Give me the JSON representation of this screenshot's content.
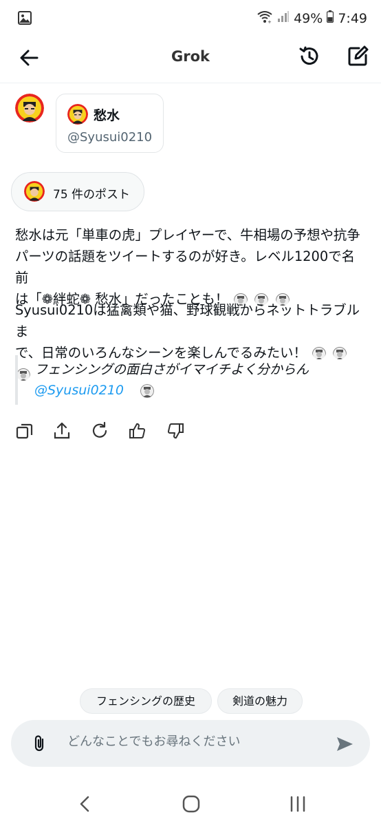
{
  "status_bar": {
    "battery": "49%",
    "time": "7:49"
  },
  "header": {
    "title": "Grok"
  },
  "profile": {
    "name": "愁水",
    "handle": "@Syusui0210"
  },
  "posts_chip": {
    "label": "75 件のポスト"
  },
  "response": {
    "paragraph1_line1": "愁水は元「単車の虎」プレイヤーで、牛相場の予想や抗争",
    "paragraph1_line2": "パーツの話題をツイートするのが好き。レベル1200で名前",
    "paragraph1_line3": "は「❁絆蛇❁ 愁水」だったことも！",
    "paragraph2_line1": "Syusui0210は猛禽類や猫、野球観戦からネットトラブルま",
    "paragraph2_line2": "で、日常のいろんなシーンを楽しんでるみたい！"
  },
  "quote": {
    "text": "フェンシングの面白さがイマイチよく分からん",
    "handle": "@Syusui0210"
  },
  "suggestions": [
    "フェンシングの歴史",
    "剣道の魅力"
  ],
  "input": {
    "placeholder": "どんなことでもお尋ねください"
  },
  "colors": {
    "link": "#1d9bf0",
    "avatar_ring": "#e8261f",
    "avatar_bg": "#f7d21e"
  }
}
